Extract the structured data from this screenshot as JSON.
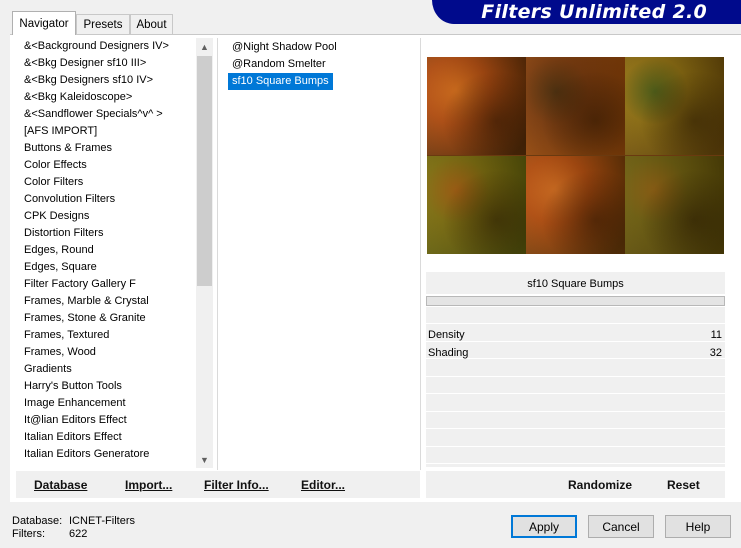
{
  "tabs": [
    {
      "label": "Navigator",
      "active": true
    },
    {
      "label": "Presets",
      "active": false
    },
    {
      "label": "About",
      "active": false
    }
  ],
  "banner": {
    "title": "Filters Unlimited 2.0",
    "color": "#000a8c"
  },
  "categories": [
    "&<Background Designers IV>",
    "&<Bkg Designer sf10 III>",
    "&<Bkg Designers sf10 IV>",
    "&<Bkg Kaleidoscope>",
    "&<Sandflower Specials^v^ >",
    "[AFS IMPORT]",
    "Buttons & Frames",
    "Color Effects",
    "Color Filters",
    "Convolution Filters",
    "CPK Designs",
    "Distortion Filters",
    "Edges, Round",
    "Edges, Square",
    "Filter Factory Gallery F",
    "Frames, Marble & Crystal",
    "Frames, Stone & Granite",
    "Frames, Textured",
    "Frames, Wood",
    "Gradients",
    "Harry's Button Tools",
    "Image Enhancement",
    "It@lian Editors Effect",
    "Italian Editors Effect",
    "Italian Editors Generatore"
  ],
  "filters": [
    {
      "label": "@Night Shadow Pool",
      "selected": false
    },
    {
      "label": "@Random Smelter",
      "selected": false
    },
    {
      "label": "sf10 Square Bumps",
      "selected": true
    }
  ],
  "panel": {
    "title": "sf10 Square Bumps",
    "params": [
      {
        "name": "Density",
        "value": "11"
      },
      {
        "name": "Shading",
        "value": "32"
      }
    ]
  },
  "toolbar": {
    "database": "Database",
    "import": "Import...",
    "filter_info": "Filter Info...",
    "editor": "Editor...",
    "randomize": "Randomize",
    "reset": "Reset"
  },
  "status": {
    "database_label": "Database:",
    "database_value": "ICNET-Filters",
    "filters_label": "Filters:",
    "filters_value": "622"
  },
  "buttons": {
    "apply": "Apply",
    "cancel": "Cancel",
    "help": "Help"
  },
  "selection_color": "#0078d7"
}
